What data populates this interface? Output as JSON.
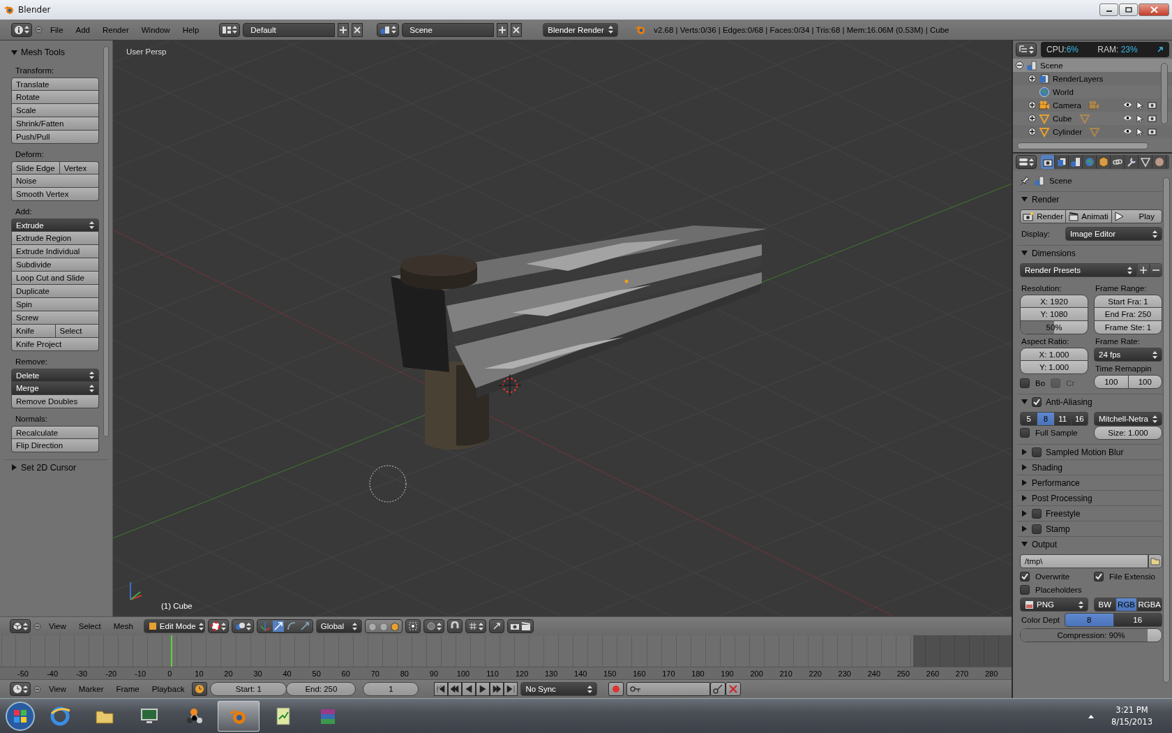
{
  "window": {
    "title": "Blender"
  },
  "info_header": {
    "menus": [
      "File",
      "Add",
      "Render",
      "Window",
      "Help"
    ],
    "layout": "Default",
    "scene": "Scene",
    "engine": "Blender Render",
    "stats": "v2.68 | Verts:0/36 | Edges:0/68 | Faces:0/34 | Tris:68 | Mem:16.06M (0.53M) | Cube"
  },
  "tool_shelf": {
    "title": "Mesh Tools",
    "footer": "Set 2D Cursor",
    "sections": [
      {
        "label": "Transform:",
        "rows": [
          [
            {
              "label": "Translate",
              "kind": "button"
            }
          ],
          [
            {
              "label": "Rotate",
              "kind": "button"
            }
          ],
          [
            {
              "label": "Scale",
              "kind": "button"
            }
          ],
          [
            {
              "label": "Shrink/Fatten",
              "kind": "button"
            }
          ],
          [
            {
              "label": "Push/Pull",
              "kind": "button"
            }
          ]
        ]
      },
      {
        "label": "Deform:",
        "rows": [
          [
            {
              "label": "Slide Edge",
              "kind": "button"
            },
            {
              "label": "Vertex",
              "kind": "button"
            }
          ],
          [
            {
              "label": "Noise",
              "kind": "button"
            }
          ],
          [
            {
              "label": "Smooth Vertex",
              "kind": "button"
            }
          ]
        ]
      },
      {
        "label": "Add:",
        "rows": [
          [
            {
              "label": "Extrude",
              "kind": "menu"
            }
          ],
          [
            {
              "label": "Extrude Region",
              "kind": "button"
            }
          ],
          [
            {
              "label": "Extrude Individual",
              "kind": "button"
            }
          ],
          [
            {
              "label": "Subdivide",
              "kind": "button"
            }
          ],
          [
            {
              "label": "Loop Cut and Slide",
              "kind": "button"
            }
          ],
          [
            {
              "label": "Duplicate",
              "kind": "button"
            }
          ],
          [
            {
              "label": "Spin",
              "kind": "button"
            }
          ],
          [
            {
              "label": "Screw",
              "kind": "button"
            }
          ],
          [
            {
              "label": "Knife",
              "kind": "button"
            },
            {
              "label": "Select",
              "kind": "button"
            }
          ],
          [
            {
              "label": "Knife Project",
              "kind": "button"
            }
          ]
        ]
      },
      {
        "label": "Remove:",
        "rows": [
          [
            {
              "label": "Delete",
              "kind": "menu"
            }
          ],
          [
            {
              "label": "Merge",
              "kind": "menu"
            }
          ],
          [
            {
              "label": "Remove Doubles",
              "kind": "button"
            }
          ]
        ]
      },
      {
        "label": "Normals:",
        "rows": [
          [
            {
              "label": "Recalculate",
              "kind": "button"
            }
          ],
          [
            {
              "label": "Flip Direction",
              "kind": "button"
            }
          ]
        ]
      }
    ]
  },
  "viewport": {
    "view_label": "User Persp",
    "object_label": "(1) Cube"
  },
  "view3d_header": {
    "menus": [
      "View",
      "Select",
      "Mesh"
    ],
    "mode": "Edit Mode",
    "orientation": "Global"
  },
  "timeline": {
    "ticks": [
      "-50",
      "-40",
      "-30",
      "-20",
      "-10",
      "0",
      "10",
      "20",
      "30",
      "40",
      "50",
      "60",
      "70",
      "80",
      "90",
      "100",
      "110",
      "120",
      "130",
      "140",
      "150",
      "160",
      "170",
      "180",
      "190",
      "200",
      "210",
      "220",
      "230",
      "240",
      "250",
      "260",
      "270",
      "280"
    ]
  },
  "timeline_header": {
    "menus": [
      "View",
      "Marker",
      "Frame",
      "Playback"
    ],
    "start": "Start: 1",
    "end": "End: 250",
    "current": "1",
    "sync": "No Sync"
  },
  "outliner": {
    "cpu_label": "CPU:",
    "cpu": "6%",
    "ram_label": "RAM:",
    "ram": "23%",
    "items": [
      {
        "name": "Scene",
        "kind": "scene",
        "expanded": true,
        "selected": true,
        "children": [
          {
            "name": "RenderLayers",
            "kind": "layers",
            "expanded": false,
            "selected": false
          },
          {
            "name": "World",
            "kind": "world",
            "selected": false
          },
          {
            "name": "Camera",
            "kind": "camera",
            "expanded": false,
            "selected": false
          },
          {
            "name": "Cube",
            "kind": "mesh",
            "expanded": false,
            "selected": false
          },
          {
            "name": "Cylinder",
            "kind": "mesh",
            "expanded": false,
            "selected": false
          }
        ]
      }
    ]
  },
  "properties": {
    "tabs": [
      {
        "kind": "render",
        "selected": true
      },
      {
        "kind": "layers",
        "selected": false
      },
      {
        "kind": "scene",
        "selected": false
      },
      {
        "kind": "world",
        "selected": false
      },
      {
        "kind": "object",
        "selected": false
      },
      {
        "kind": "constraints",
        "selected": false
      },
      {
        "kind": "modifiers",
        "selected": false
      },
      {
        "kind": "data",
        "selected": false
      },
      {
        "kind": "material",
        "selected": false
      }
    ],
    "context": "Scene",
    "panels": [
      {
        "kind": "render",
        "title": "Render",
        "expanded": true,
        "buttons": [
          {
            "label": "Render",
            "kind": "render"
          },
          {
            "label": "Animati",
            "kind": "animation"
          },
          {
            "label": "Play",
            "kind": "play"
          }
        ],
        "display_label": "Display:",
        "display": "Image Editor"
      },
      {
        "kind": "dimensions",
        "title": "Dimensions",
        "expanded": true,
        "presets": "Render Presets",
        "resolution_label": "Resolution:",
        "res_x": "X: 1920",
        "res_y": "Y: 1080",
        "percent": {
          "label": "50%",
          "level": 0.5
        },
        "frame_range_label": "Frame Range:",
        "start": "Start Fra: 1",
        "end": "End Fra: 250",
        "step": "Frame Ste: 1",
        "aspect_label": "Aspect Ratio:",
        "aspect_x": "X: 1.000",
        "aspect_y": "Y: 1.000",
        "frame_rate_label": "Frame Rate:",
        "frame_rate": "24 fps",
        "remap_label": "Time Remappin",
        "remap_old": "100",
        "remap_new": "100",
        "border": {
          "label": "Bo",
          "checked": false,
          "disabled": false
        },
        "crop": {
          "label": "Cr",
          "checked": false,
          "disabled": true
        }
      },
      {
        "kind": "antialiasing",
        "title": "Anti-Aliasing",
        "expanded": true,
        "checked": true,
        "samples": [
          {
            "label": "5",
            "selected": false
          },
          {
            "label": "8",
            "selected": true
          },
          {
            "label": "11",
            "selected": false
          },
          {
            "label": "16",
            "selected": false
          }
        ],
        "filter": "Mitchell-Netra",
        "full_sample": {
          "label": "Full Sample",
          "checked": false
        },
        "size": "Size: 1.000"
      },
      {
        "kind": "panel",
        "title": "Sampled Motion Blur",
        "expanded": false,
        "checked": false
      },
      {
        "kind": "panel",
        "title": "Shading",
        "expanded": false
      },
      {
        "kind": "panel",
        "title": "Performance",
        "expanded": false
      },
      {
        "kind": "panel",
        "title": "Post Processing",
        "expanded": false
      },
      {
        "kind": "panel",
        "title": "Freestyle",
        "expanded": false,
        "checked": false
      },
      {
        "kind": "panel",
        "title": "Stamp",
        "expanded": false,
        "checked": false
      },
      {
        "kind": "output",
        "title": "Output",
        "expanded": true,
        "path": "/tmp\\",
        "options": [
          {
            "label": "Overwrite",
            "checked": true
          },
          {
            "label": "File Extensio",
            "checked": true
          },
          {
            "label": "Placeholders",
            "checked": false
          }
        ],
        "format": "PNG",
        "color_modes": [
          {
            "label": "BW",
            "selected": false
          },
          {
            "label": "RGB",
            "selected": true
          },
          {
            "label": "RGBA",
            "selected": false
          }
        ],
        "depth_label": "Color Dept",
        "depths": [
          {
            "label": "8",
            "selected": true
          },
          {
            "label": "16",
            "selected": false
          }
        ],
        "compression": {
          "label": "Compression: 90%",
          "level": 0.9
        }
      }
    ]
  },
  "taskbar": {
    "apps": [
      {
        "kind": "browser",
        "selected": false
      },
      {
        "kind": "folder",
        "selected": false
      },
      {
        "kind": "monitor",
        "selected": false
      },
      {
        "kind": "molecule",
        "selected": false
      },
      {
        "kind": "blender",
        "selected": true
      },
      {
        "kind": "notepad",
        "selected": false
      },
      {
        "kind": "archive",
        "selected": false
      }
    ],
    "time": "3:21 PM",
    "date": "8/15/2013"
  }
}
